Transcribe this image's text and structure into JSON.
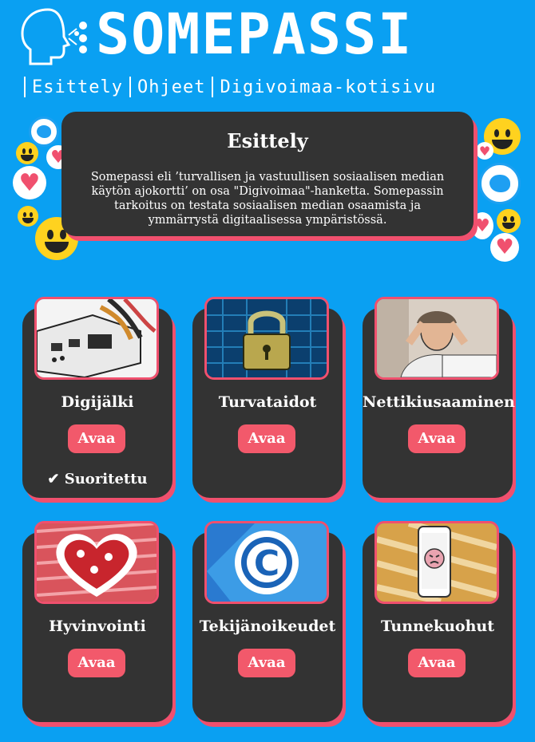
{
  "brand": {
    "title": "SOMEPASSI"
  },
  "nav": {
    "items": [
      "Esittely",
      "Ohjeet",
      "Digivoimaa-kotisivu"
    ]
  },
  "intro": {
    "heading": "Esittely",
    "text": "Somepassi eli ’turvallisen ja vastuullisen sosiaalisen median käytön ajokortti’ on osa \"Digivoimaa\"-hanketta. Somepassin tarkoitus on testata sosiaalisen median osaamista ja ymmärrystä digitaalisessa ympäristössä."
  },
  "cards": [
    {
      "title": "Digijälki",
      "button": "Avaa",
      "status": "✔ Suoritettu"
    },
    {
      "title": "Turvataidot",
      "button": "Avaa"
    },
    {
      "title": "Nettikiusaaminen",
      "button": "Avaa"
    },
    {
      "title": "Hyvinvointi",
      "button": "Avaa"
    },
    {
      "title": "Tekijänoikeudet",
      "button": "Avaa"
    },
    {
      "title": "Tunnekuohut",
      "button": "Avaa"
    }
  ],
  "colors": {
    "background": "#0aa0f2",
    "card": "#333333",
    "accent": "#f0506e"
  }
}
